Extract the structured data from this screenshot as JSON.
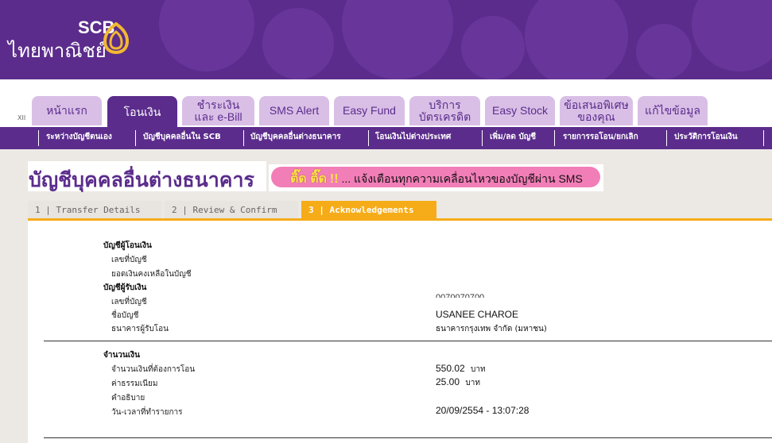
{
  "brand": {
    "name": "SCB",
    "thai_name": "ไทยพาณิชย์"
  },
  "nav": {
    "xii": "XII",
    "tabs": [
      {
        "label": "หน้าแรก"
      },
      {
        "label": "โอนเงิน"
      },
      {
        "label": "ชำระเงิน\nและ e-Bill"
      },
      {
        "label": "SMS Alert"
      },
      {
        "label": "Easy Fund"
      },
      {
        "label": "บริการ\nบัตรเครดิต"
      },
      {
        "label": "Easy Stock"
      },
      {
        "label": "ข้อเสนอพิเศษ\nของคุณ"
      },
      {
        "label": "แก้ไขข้อมูล"
      }
    ],
    "subnav": [
      "ระหว่างบัญชีตนเอง",
      "บัญชีบุคคลอื่นใน SCB",
      "บัญชีบุคคลอื่นต่างธนาคาร",
      "โอนเงินไปต่างประเทศ",
      "เพิ่ม/ลด บัญชี",
      "รายการรอโอน/ยกเลิก",
      "ประวัติการโอนเงิน"
    ]
  },
  "page": {
    "title": "บัญชีบุคคลอื่นต่างธนาคาร",
    "sms_banner": {
      "highlight": "ติ๊ด ติ๊ด",
      "excl": "!!",
      "text": "... แจ้งเตือนทุกความเคลื่อนไหวของบัญชีผ่าน SMS"
    }
  },
  "steps": [
    {
      "label": "1 | Transfer Details"
    },
    {
      "label": "2 | Review & Confirm"
    },
    {
      "label": "3 | Acknowledgements"
    }
  ],
  "from_account": {
    "heading": "บัญชีผู้โอนเงิน",
    "account_no_label": "เลขที่บัญชี",
    "balance_label": "ยอดเงินคงเหลือในบัญชี"
  },
  "to_account": {
    "heading": "บัญชีผู้รับเงิน",
    "account_no_label": "เลขที่บัญชี",
    "account_no_value": "0070070700",
    "name_label": "ชื่อบัญชี",
    "name_value": "USANEE CHAROE",
    "bank_label": "ธนาคารผู้รับโอน",
    "bank_value": "ธนาคารกรุงเทพ จำกัด (มหาชน)"
  },
  "amount": {
    "heading": "จำนวนเงิน",
    "transfer_label": "จำนวนเงินที่ต้องการโอน",
    "transfer_value": "550.02",
    "fee_label": "ค่าธรรมเนียม",
    "fee_value": "25.00",
    "currency": "บาท",
    "desc_label": "คำอธิบาย",
    "datetime_label": "วัน-เวลาที่ทำรายการ",
    "datetime_value": "20/09/2554 - 13:07:28"
  }
}
